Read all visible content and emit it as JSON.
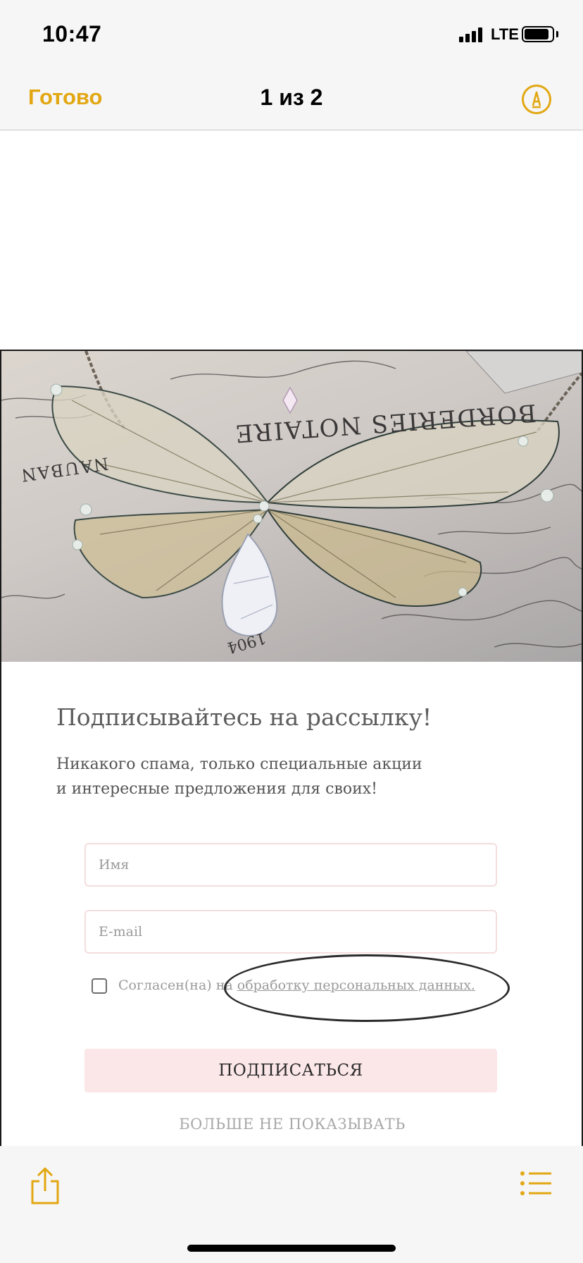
{
  "status_bar": {
    "time": "10:47",
    "network": "LTE"
  },
  "nav": {
    "done_label": "Готово",
    "page_counter": "1 из 2",
    "accent_color": "#e2a712",
    "markup_icon": "markup-pen-icon"
  },
  "document": {
    "hero_image": {
      "description_icon": "butterfly-wing-necklace-photo",
      "printed_text": [
        "BORDERIES NOTAIRE",
        "NAUBAN",
        "1904"
      ]
    },
    "popup": {
      "heading": "Подписывайтесь на рассылку!",
      "subtitle_line1": "Никакого спама, только специальные акции",
      "subtitle_line2": "и интересные предложения для своих!",
      "name_placeholder": "Имя",
      "email_placeholder": "E-mail",
      "consent_prefix": "Согласен(на) на ",
      "consent_link": "обработку персональных данных.",
      "consent_checked": false,
      "subscribe_label": "ПОДПИСАТЬСЯ",
      "dont_show_label": "БОЛЬШЕ НЕ ПОКАЗЫВАТЬ",
      "button_color": "#fbe6e8"
    }
  },
  "toolbar": {
    "share_icon": "share-icon",
    "list_icon": "list-icon"
  }
}
